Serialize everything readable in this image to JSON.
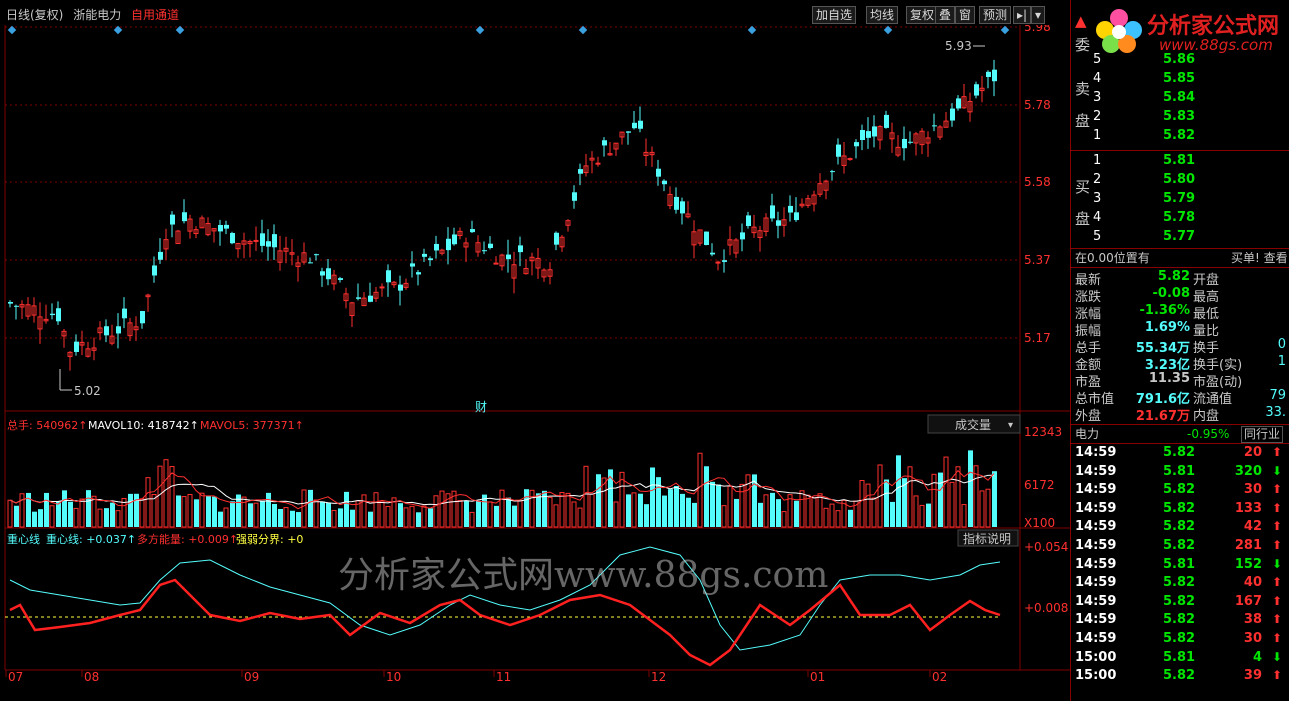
{
  "header": {
    "chart_title": "日线(复权)",
    "stock_name": "浙能电力",
    "tag": "自用通道",
    "buttons": [
      "加自选",
      "均线",
      "复权",
      "叠",
      "窗",
      "预测"
    ]
  },
  "price_axis": [
    "5.98",
    "5.78",
    "5.58",
    "5.37",
    "5.17"
  ],
  "price_annotations": {
    "high": "5.93",
    "low": "5.02",
    "event": "财"
  },
  "volume_header": {
    "total_label": "总手: 540962↑",
    "mavol10_label": "MAVOL10: 418742↑",
    "mavol5_label": "MAVOL5: 377371↑",
    "dropdown": "成交量",
    "axis": [
      "12343",
      "6172",
      "X100"
    ]
  },
  "indicator_header": {
    "name": "重心线",
    "line1": "重心线: +0.037↑",
    "line2": "多方能量: +0.009↑",
    "line3": "强弱分界: +0",
    "help_button": "指标说明",
    "axis": [
      "+0.054",
      "+0.008"
    ]
  },
  "watermark": "分析家公式网www.88gs.com",
  "x_axis": [
    "07",
    "08",
    "09",
    "10",
    "11",
    "12",
    "01",
    "02"
  ],
  "logo": {
    "title": "分析家公式网",
    "url": "www.88gs.com"
  },
  "orderbook": {
    "sell_label": [
      "委",
      "卖",
      "盘"
    ],
    "buy_label": [
      "买",
      "盘"
    ],
    "sell": [
      {
        "level": "5",
        "price": "5.86"
      },
      {
        "level": "4",
        "price": "5.85"
      },
      {
        "level": "3",
        "price": "5.84"
      },
      {
        "level": "2",
        "price": "5.83"
      },
      {
        "level": "1",
        "price": "5.82"
      }
    ],
    "buy": [
      {
        "level": "1",
        "price": "5.81"
      },
      {
        "level": "2",
        "price": "5.80"
      },
      {
        "level": "3",
        "price": "5.79"
      },
      {
        "level": "4",
        "price": "5.78"
      },
      {
        "level": "5",
        "price": "5.77"
      }
    ],
    "position_line": "在0.00位置有",
    "position_right": "买单! 查看"
  },
  "quote": [
    {
      "k1": "最新",
      "v1": "5.82",
      "k2": "开盘",
      "v2": ""
    },
    {
      "k1": "涨跌",
      "v1": "-0.08",
      "k2": "最高",
      "v2": ""
    },
    {
      "k1": "涨幅",
      "v1": "-1.36%",
      "k2": "最低",
      "v2": ""
    },
    {
      "k1": "振幅",
      "v1": "1.69%",
      "k2": "量比",
      "v2": ""
    },
    {
      "k1": "总手",
      "v1": "55.34万",
      "k2": "换手",
      "v2": "0"
    },
    {
      "k1": "金额",
      "v1": "3.23亿",
      "k2": "换手(实)",
      "v2": "1"
    },
    {
      "k1": "市盈",
      "v1": "11.35",
      "k2": "市盈(动)",
      "v2": ""
    },
    {
      "k1": "总市值",
      "v1": "791.6亿",
      "k2": "流通值",
      "v2": "79"
    },
    {
      "k1": "外盘",
      "v1": "21.67万",
      "k2": "内盘",
      "v2": "33."
    }
  ],
  "sector": {
    "name": "电力",
    "change": "-0.95%",
    "button": "同行业"
  },
  "ticks": [
    {
      "time": "14:59",
      "price": "5.82",
      "vol": "20",
      "dir": "up"
    },
    {
      "time": "14:59",
      "price": "5.81",
      "vol": "320",
      "dir": "down"
    },
    {
      "time": "14:59",
      "price": "5.82",
      "vol": "30",
      "dir": "up"
    },
    {
      "time": "14:59",
      "price": "5.82",
      "vol": "133",
      "dir": "up"
    },
    {
      "time": "14:59",
      "price": "5.82",
      "vol": "42",
      "dir": "up"
    },
    {
      "time": "14:59",
      "price": "5.82",
      "vol": "281",
      "dir": "up"
    },
    {
      "time": "14:59",
      "price": "5.81",
      "vol": "152",
      "dir": "down"
    },
    {
      "time": "14:59",
      "price": "5.82",
      "vol": "40",
      "dir": "up"
    },
    {
      "time": "14:59",
      "price": "5.82",
      "vol": "167",
      "dir": "up"
    },
    {
      "time": "14:59",
      "price": "5.82",
      "vol": "38",
      "dir": "up"
    },
    {
      "time": "14:59",
      "price": "5.82",
      "vol": "30",
      "dir": "up"
    },
    {
      "time": "15:00",
      "price": "5.81",
      "vol": "4",
      "dir": "down"
    },
    {
      "time": "15:00",
      "price": "5.82",
      "vol": "39",
      "dir": "up"
    }
  ],
  "colors": {
    "up": "#ff3030",
    "down": "#54fcfc",
    "grid": "#800000",
    "text": "#c8c8c8"
  }
}
